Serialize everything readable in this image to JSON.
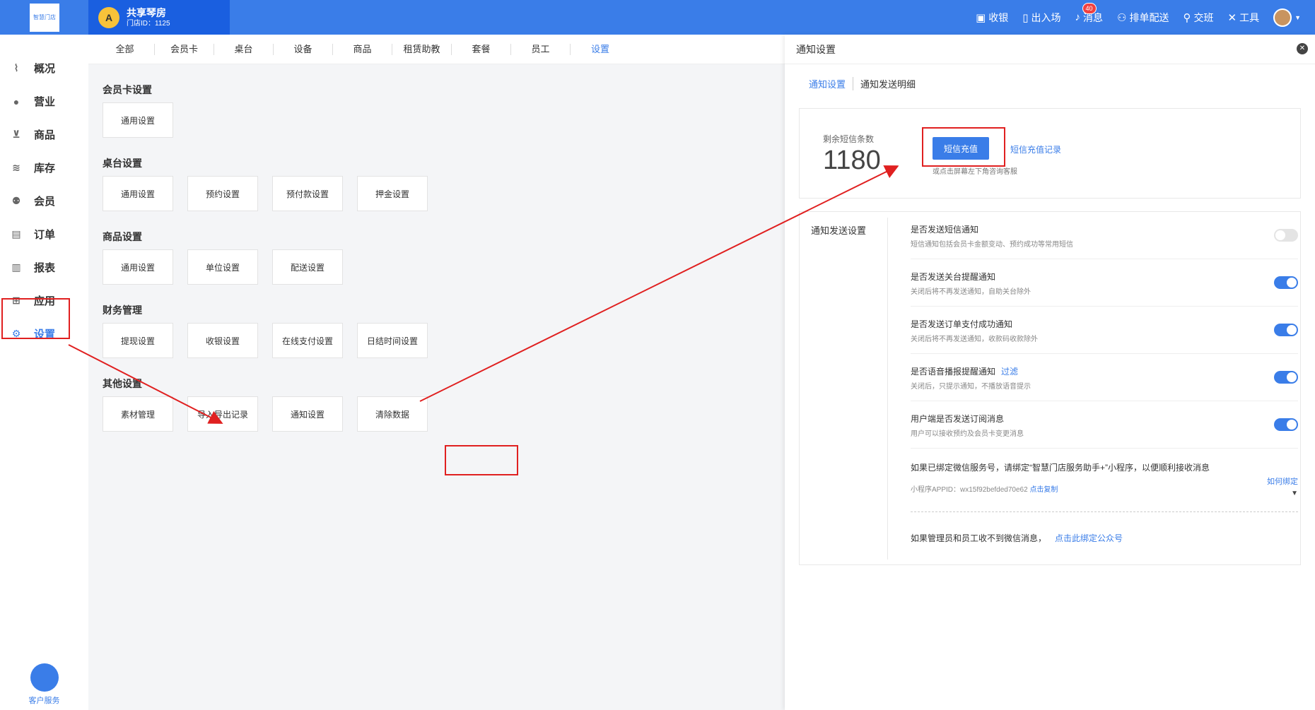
{
  "topbar": {
    "logo_text": "智慧门店",
    "store_avatar_text": "A",
    "store_name": "共享琴房",
    "store_id": "门店ID：1125",
    "actions": [
      {
        "label": "收银",
        "icon": "cashier-icon",
        "glyph": "▣"
      },
      {
        "label": "出入场",
        "icon": "door-icon",
        "glyph": "▯"
      },
      {
        "label": "消息",
        "icon": "bell-icon",
        "glyph": "♪",
        "badge": "40"
      },
      {
        "label": "排单配送",
        "icon": "people-icon",
        "glyph": "⚇"
      },
      {
        "label": "交班",
        "icon": "user-swap-icon",
        "glyph": "⚲"
      },
      {
        "label": "工具",
        "icon": "tools-icon",
        "glyph": "✕"
      }
    ]
  },
  "sidebar": {
    "items": [
      {
        "label": "概况",
        "icon": "chart-line-icon",
        "glyph": "⌇"
      },
      {
        "label": "营业",
        "icon": "money-bag-icon",
        "glyph": "●"
      },
      {
        "label": "商品",
        "icon": "cart-icon",
        "glyph": "⊻"
      },
      {
        "label": "库存",
        "icon": "layers-icon",
        "glyph": "≋"
      },
      {
        "label": "会员",
        "icon": "members-icon",
        "glyph": "⚉"
      },
      {
        "label": "订单",
        "icon": "order-icon",
        "glyph": "▤"
      },
      {
        "label": "报表",
        "icon": "bar-chart-icon",
        "glyph": "▥"
      },
      {
        "label": "应用",
        "icon": "apps-icon",
        "glyph": "⊞"
      },
      {
        "label": "设置",
        "icon": "gear-icon",
        "glyph": "⚙"
      }
    ],
    "service_label": "客户服务"
  },
  "main": {
    "tabs": [
      "全部",
      "会员卡",
      "桌台",
      "设备",
      "商品",
      "租赁助教",
      "套餐",
      "员工",
      "设置"
    ],
    "sections": [
      {
        "title": "会员卡设置",
        "buttons": [
          "通用设置"
        ]
      },
      {
        "title": "桌台设置",
        "buttons": [
          "通用设置",
          "预约设置",
          "预付款设置",
          "押金设置"
        ]
      },
      {
        "title": "商品设置",
        "buttons": [
          "通用设置",
          "单位设置",
          "配送设置"
        ]
      },
      {
        "title": "财务管理",
        "buttons": [
          "提现设置",
          "收银设置",
          "在线支付设置",
          "日结时间设置"
        ]
      },
      {
        "title": "其他设置",
        "buttons": [
          "素材管理",
          "导入导出记录",
          "通知设置",
          "清除数据"
        ]
      }
    ]
  },
  "panel": {
    "title": "通知设置",
    "close": "✕",
    "tabs": [
      "通知设置",
      "通知发送明细"
    ],
    "sms": {
      "label": "剩余短信条数",
      "count": "1180",
      "recharge_button": "短信充值",
      "recharge_link": "短信充值记录",
      "tip": "或点击屏幕左下角咨询客服"
    },
    "notify": {
      "label": "通知发送设置",
      "rows": [
        {
          "title": "是否发送短信通知",
          "desc": "短信通知包括会员卡金额变动、预约成功等常用短信",
          "enabled": false
        },
        {
          "title": "是否发送关台提醒通知",
          "desc": "关闭后将不再发送通知，自助关台除外",
          "enabled": true
        },
        {
          "title": "是否发送订单支付成功通知",
          "desc": "关闭后将不再发送通知，收款码收款除外",
          "enabled": true
        },
        {
          "title": "是否语音播报提醒通知",
          "link": "过滤",
          "desc": "关闭后，只提示通知，不播放语音提示",
          "enabled": true
        },
        {
          "title": "用户端是否发送订阅消息",
          "desc": "用户可以接收预约及会员卡变更消息",
          "enabled": true
        }
      ],
      "wx_text": "如果已绑定微信服务号，请绑定“智慧门店服务助手+”小程序，以便顺利接收消息",
      "wx_appid_label": "小程序APPID：",
      "wx_appid": "wx15f92befded70e62",
      "wx_copy": "点击复制",
      "wx_how": "如何绑定",
      "wx_arrow": "▼",
      "admin_text": "如果管理员和员工收不到微信消息，",
      "admin_link": "点击此绑定公众号"
    }
  },
  "colors": {
    "accent": "#3a7de8",
    "store_bg": "#1a5fe0",
    "highlight": "#e02020"
  }
}
